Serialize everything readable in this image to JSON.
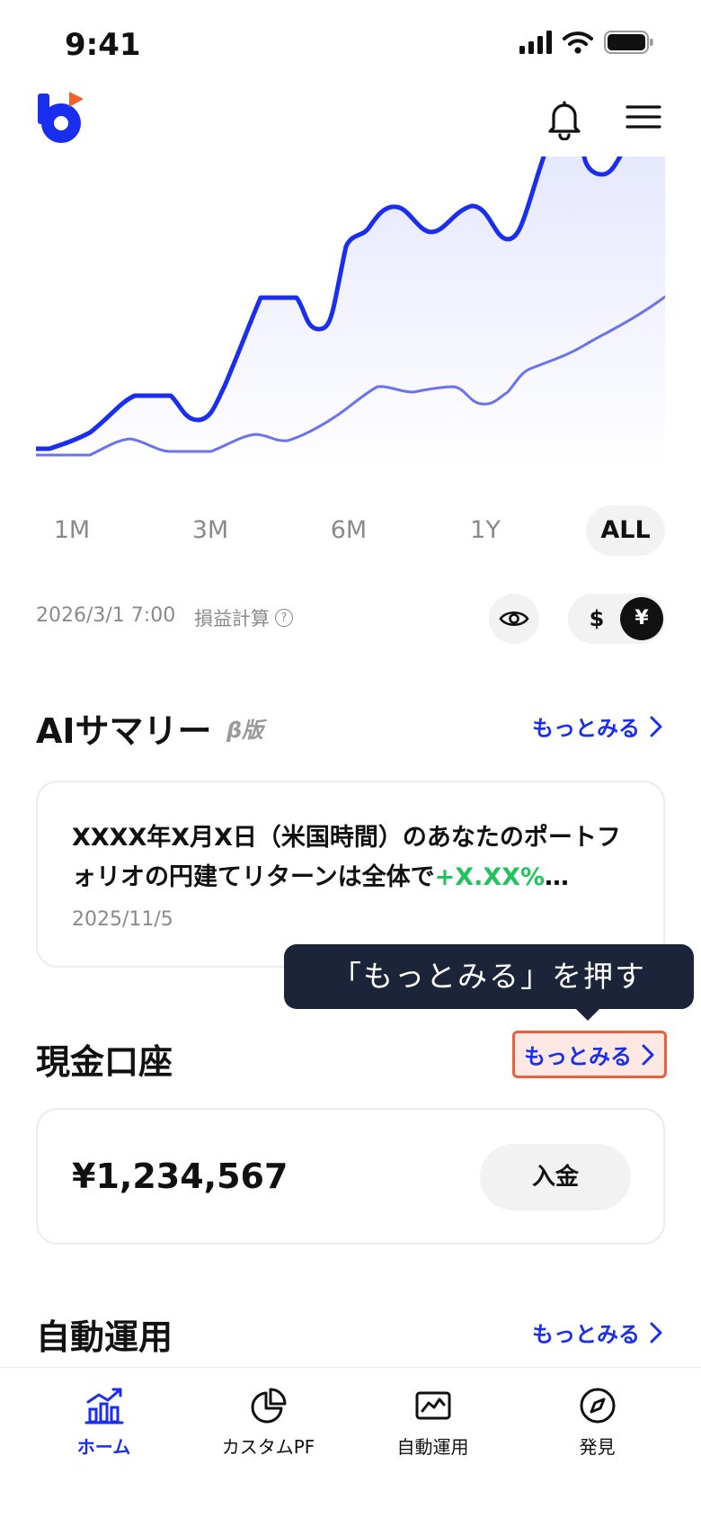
{
  "status": {
    "time": "9:41"
  },
  "colors": {
    "accent": "#1a2ef0",
    "positive": "#22c35e",
    "tooltip": "#1b2438",
    "highlight_border": "#e8603c",
    "logo_dot": "#f0602a"
  },
  "chart": {
    "series_main_color": "#1a2ef0",
    "series_benchmark_color": "#6b72f0"
  },
  "range_tabs": [
    {
      "label": "1M",
      "active": false
    },
    {
      "label": "3M",
      "active": false
    },
    {
      "label": "6M",
      "active": false
    },
    {
      "label": "1Y",
      "active": false
    },
    {
      "label": "ALL",
      "active": true
    }
  ],
  "meta": {
    "date": "2026/3/1 7:00",
    "pl_label": "損益計算",
    "help_glyph": "?",
    "currency_usd": "$",
    "currency_jpy": "¥"
  },
  "ai_summary": {
    "title": "AIサマリー",
    "beta": "β版",
    "more": "もっとみる",
    "text_before": "XXXX年X月X日（米国時間）のあなたのポートフォリオの円建てリターンは全体で",
    "text_value": "+X.XX%",
    "text_after": "…",
    "date": "2025/11/5"
  },
  "tooltip": {
    "text": "「もっとみる」を押す"
  },
  "cash": {
    "title": "現金口座",
    "more": "もっとみる",
    "amount": "¥1,234,567",
    "deposit": "入金"
  },
  "auto_invest": {
    "title": "自動運用",
    "more": "もっとみる"
  },
  "tab_bar": [
    {
      "label": "ホーム",
      "icon": "home-chart-icon",
      "active": true
    },
    {
      "label": "カスタムPF",
      "icon": "pie-chart-icon",
      "active": false
    },
    {
      "label": "自動運用",
      "icon": "line-chart-icon",
      "active": false
    },
    {
      "label": "発見",
      "icon": "compass-icon",
      "active": false
    }
  ]
}
